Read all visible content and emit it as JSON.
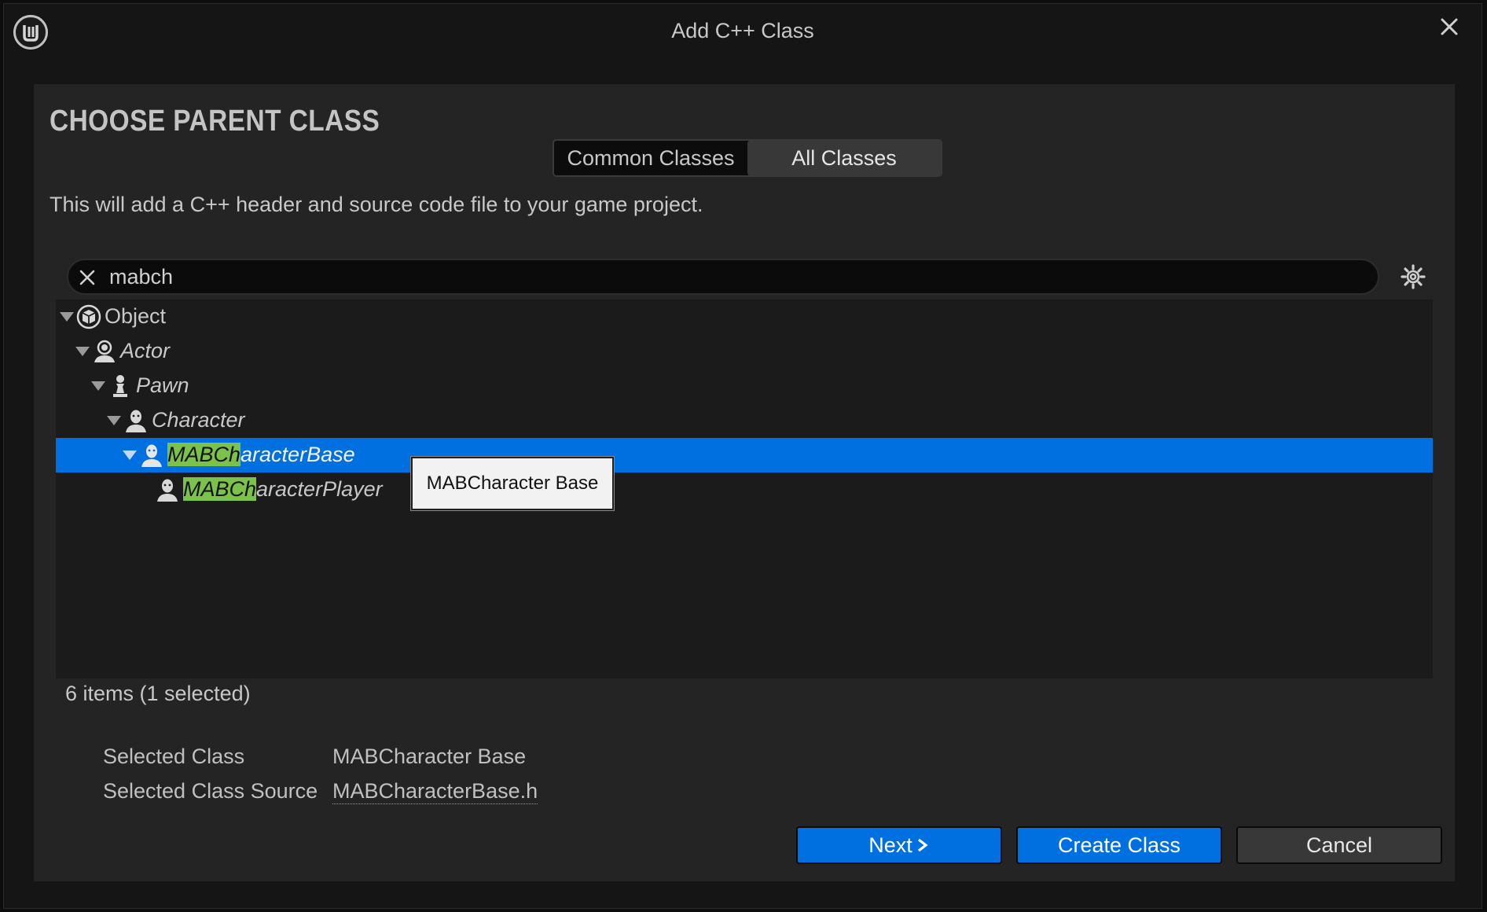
{
  "window": {
    "title": "Add C++ Class"
  },
  "panel": {
    "heading": "CHOOSE PARENT CLASS",
    "tabs": [
      {
        "label": "Common Classes",
        "active": false
      },
      {
        "label": "All Classes",
        "active": true
      }
    ],
    "description": "This will add a C++ header and source code file to your game project."
  },
  "search": {
    "value": "mabch"
  },
  "tree": {
    "rows": [
      {
        "hl": "",
        "rest": "Object",
        "icon": "object-icon",
        "expanded": true,
        "italic": false,
        "selected": false
      },
      {
        "hl": "",
        "rest": "Actor",
        "icon": "actor-icon",
        "expanded": true,
        "italic": true,
        "selected": false
      },
      {
        "hl": "",
        "rest": "Pawn",
        "icon": "pawn-icon",
        "expanded": true,
        "italic": true,
        "selected": false
      },
      {
        "hl": "",
        "rest": "Character",
        "icon": "character-icon",
        "expanded": true,
        "italic": true,
        "selected": false
      },
      {
        "hl": "MABCh",
        "rest": "aracterBase",
        "icon": "character-icon",
        "expanded": true,
        "italic": true,
        "selected": true
      },
      {
        "hl": "MABCh",
        "rest": "aracterPlayer",
        "icon": "character-icon",
        "expanded": false,
        "italic": true,
        "selected": false
      }
    ],
    "tooltip": "MABCharacter Base"
  },
  "status": {
    "count": "6 items (1 selected)"
  },
  "selection": {
    "class_label": "Selected Class",
    "class_value": "MABCharacter Base",
    "source_label": "Selected Class Source",
    "source_value": "MABCharacterBase.h"
  },
  "buttons": {
    "next": "Next",
    "create": "Create Class",
    "cancel": "Cancel"
  },
  "colors": {
    "accent": "#0070e0",
    "highlight": "#7ac24a",
    "background": "#242424"
  }
}
